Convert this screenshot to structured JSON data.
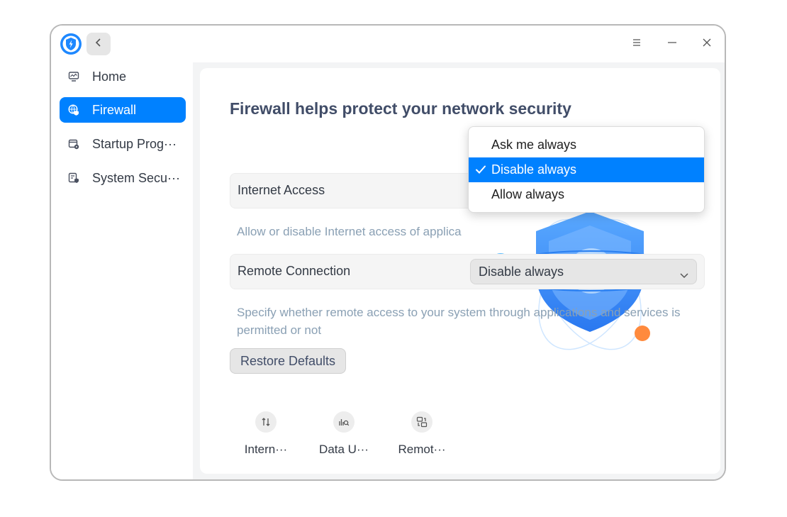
{
  "header": {
    "logo_icon": "security-shield-logo-icon",
    "back_icon": "chevron-left-icon",
    "menu_icon": "menu-icon",
    "minimize_icon": "minimize-icon",
    "close_icon": "close-icon"
  },
  "sidebar": {
    "items": [
      {
        "label": "Home",
        "icon": "monitor-icon",
        "active": false
      },
      {
        "label": "Firewall",
        "icon": "globe-shield-icon",
        "active": true
      },
      {
        "label": "Startup Prog···",
        "icon": "startup-programs-icon",
        "active": false
      },
      {
        "label": "System Secu···",
        "icon": "system-security-icon",
        "active": false
      }
    ]
  },
  "main": {
    "title": "Firewall helps protect your network security",
    "internet_access": {
      "label": "Internet Access",
      "description": "Allow or disable Internet access of applica"
    },
    "remote_connection": {
      "label": "Remote Connection",
      "value": "Disable always",
      "description": "Specify whether remote access to your system through applications and services is permitted or not"
    },
    "restore_label": "Restore Defaults",
    "tools": [
      {
        "label": "Intern···",
        "icon": "internet-control-icon"
      },
      {
        "label": "Data U···",
        "icon": "data-usage-icon"
      },
      {
        "label": "Remot···",
        "icon": "remote-connection-icon"
      }
    ]
  },
  "dropdown": {
    "options": [
      "Ask me always",
      "Disable always",
      "Allow always"
    ],
    "selected": "Disable always"
  },
  "colors": {
    "accent": "#0081ff",
    "title": "#414d68",
    "description": "#8aa0b4",
    "content_bg": "#f3f4f5"
  }
}
